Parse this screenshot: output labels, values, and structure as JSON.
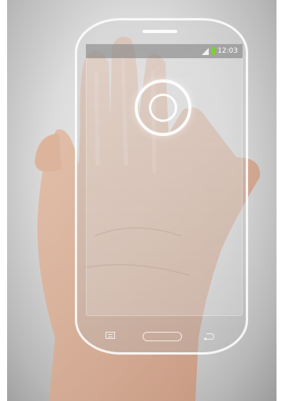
{
  "status_bar": {
    "time": "12:03",
    "icons": [
      "signal-icon",
      "battery-icon"
    ]
  },
  "screen": {
    "touch_target_icon": "concentric-circle-icon"
  },
  "nav_bar": {
    "buttons": [
      "menu-icon",
      "home-button",
      "back-icon"
    ]
  },
  "colors": {
    "battery": "#7fcf2f",
    "backdrop": "#dcdcdc",
    "skin": "#d9b199"
  }
}
